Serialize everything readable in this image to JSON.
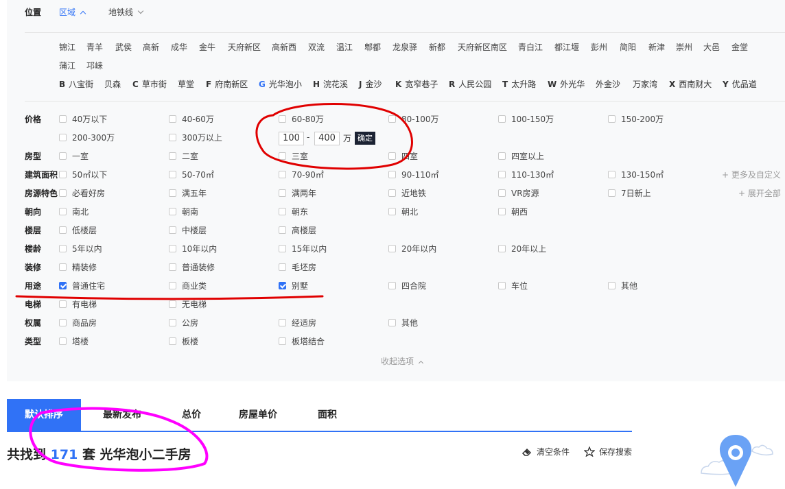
{
  "location": {
    "label": "位置",
    "tabs": [
      {
        "label": "区域",
        "active": true
      },
      {
        "label": "地铁线",
        "active": false
      }
    ],
    "districts_row1": [
      "锦江",
      "青羊",
      "武侯",
      "高新",
      "成华",
      "金牛",
      "天府新区",
      "高新西",
      "双流",
      "温江",
      "郫都",
      "龙泉驿",
      "新都",
      "天府新区南区",
      "青白江",
      "都江堰",
      "彭州",
      "简阳",
      "新津",
      "崇州",
      "大邑",
      "金堂"
    ],
    "districts_row2": [
      "蒲江",
      "邛崃"
    ],
    "active_district": "青羊",
    "metro_letters": [
      {
        "letter": "B",
        "name": "八宝街"
      },
      {
        "letter": "",
        "name": "贝森"
      },
      {
        "letter": "C",
        "name": "草市街"
      },
      {
        "letter": "",
        "name": "草堂"
      },
      {
        "letter": "F",
        "name": "府南新区"
      },
      {
        "letter": "G",
        "name": "光华泡小",
        "active": true
      },
      {
        "letter": "H",
        "name": "浣花溪"
      },
      {
        "letter": "J",
        "name": "金沙"
      },
      {
        "letter": "K",
        "name": "宽窄巷子"
      },
      {
        "letter": "R",
        "name": "人民公园"
      },
      {
        "letter": "T",
        "name": "太升路"
      },
      {
        "letter": "W",
        "name": "外光华"
      },
      {
        "letter": "",
        "name": "外金沙"
      },
      {
        "letter": "",
        "name": "万家湾"
      },
      {
        "letter": "X",
        "name": "西南财大"
      },
      {
        "letter": "Y",
        "name": "优品道"
      }
    ]
  },
  "filters": {
    "price": {
      "label": "价格",
      "options": [
        "40万以下",
        "40-60万",
        "60-80万",
        "80-100万",
        "100-150万",
        "150-200万",
        "200-300万",
        "300万以上"
      ],
      "custom_min": "100",
      "custom_max": "400",
      "unit": "万",
      "confirm": "确定",
      "dash": "-"
    },
    "layout": {
      "label": "房型",
      "options": [
        "一室",
        "二室",
        "三室",
        "四室",
        "四室以上"
      ]
    },
    "area": {
      "label": "建筑面积",
      "options": [
        "50㎡以下",
        "50-70㎡",
        "70-90㎡",
        "90-110㎡",
        "110-130㎡",
        "130-150㎡"
      ],
      "more": "+ 更多及自定义"
    },
    "features": {
      "label": "房源特色",
      "options": [
        "必看好房",
        "满五年",
        "满两年",
        "近地铁",
        "VR房源",
        "7日新上"
      ],
      "more": "+ 展开全部"
    },
    "orientation": {
      "label": "朝向",
      "options": [
        "南北",
        "朝南",
        "朝东",
        "朝北",
        "朝西"
      ]
    },
    "floor": {
      "label": "楼层",
      "options": [
        "低楼层",
        "中楼层",
        "高楼层"
      ]
    },
    "age": {
      "label": "楼龄",
      "options": [
        "5年以内",
        "10年以内",
        "15年以内",
        "20年以内",
        "20年以上"
      ]
    },
    "decoration": {
      "label": "装修",
      "options": [
        "精装修",
        "普通装修",
        "毛坯房"
      ]
    },
    "usage": {
      "label": "用途",
      "options": [
        "普通住宅",
        "商业类",
        "别墅",
        "四合院",
        "车位",
        "其他"
      ],
      "checked": [
        0,
        2
      ]
    },
    "elevator": {
      "label": "电梯",
      "options": [
        "有电梯",
        "无电梯"
      ]
    },
    "ownership": {
      "label": "权属",
      "options": [
        "商品房",
        "公房",
        "经适房",
        "其他"
      ]
    },
    "type": {
      "label": "类型",
      "options": [
        "塔楼",
        "板楼",
        "板塔结合"
      ]
    },
    "collapse": "收起选项"
  },
  "sort_tabs": [
    "默认排序",
    "最新发布",
    "总价",
    "房屋单价",
    "面积"
  ],
  "result": {
    "prefix": "共找到",
    "count": "171",
    "suffix": "套 光华泡小二手房"
  },
  "actions": {
    "clear": "清空条件",
    "save": "保存搜索"
  },
  "colors": {
    "accent": "#3072f6",
    "annotation_red": "#e00000",
    "annotation_magenta": "#ff00ff",
    "dark_button": "#1c2333"
  }
}
